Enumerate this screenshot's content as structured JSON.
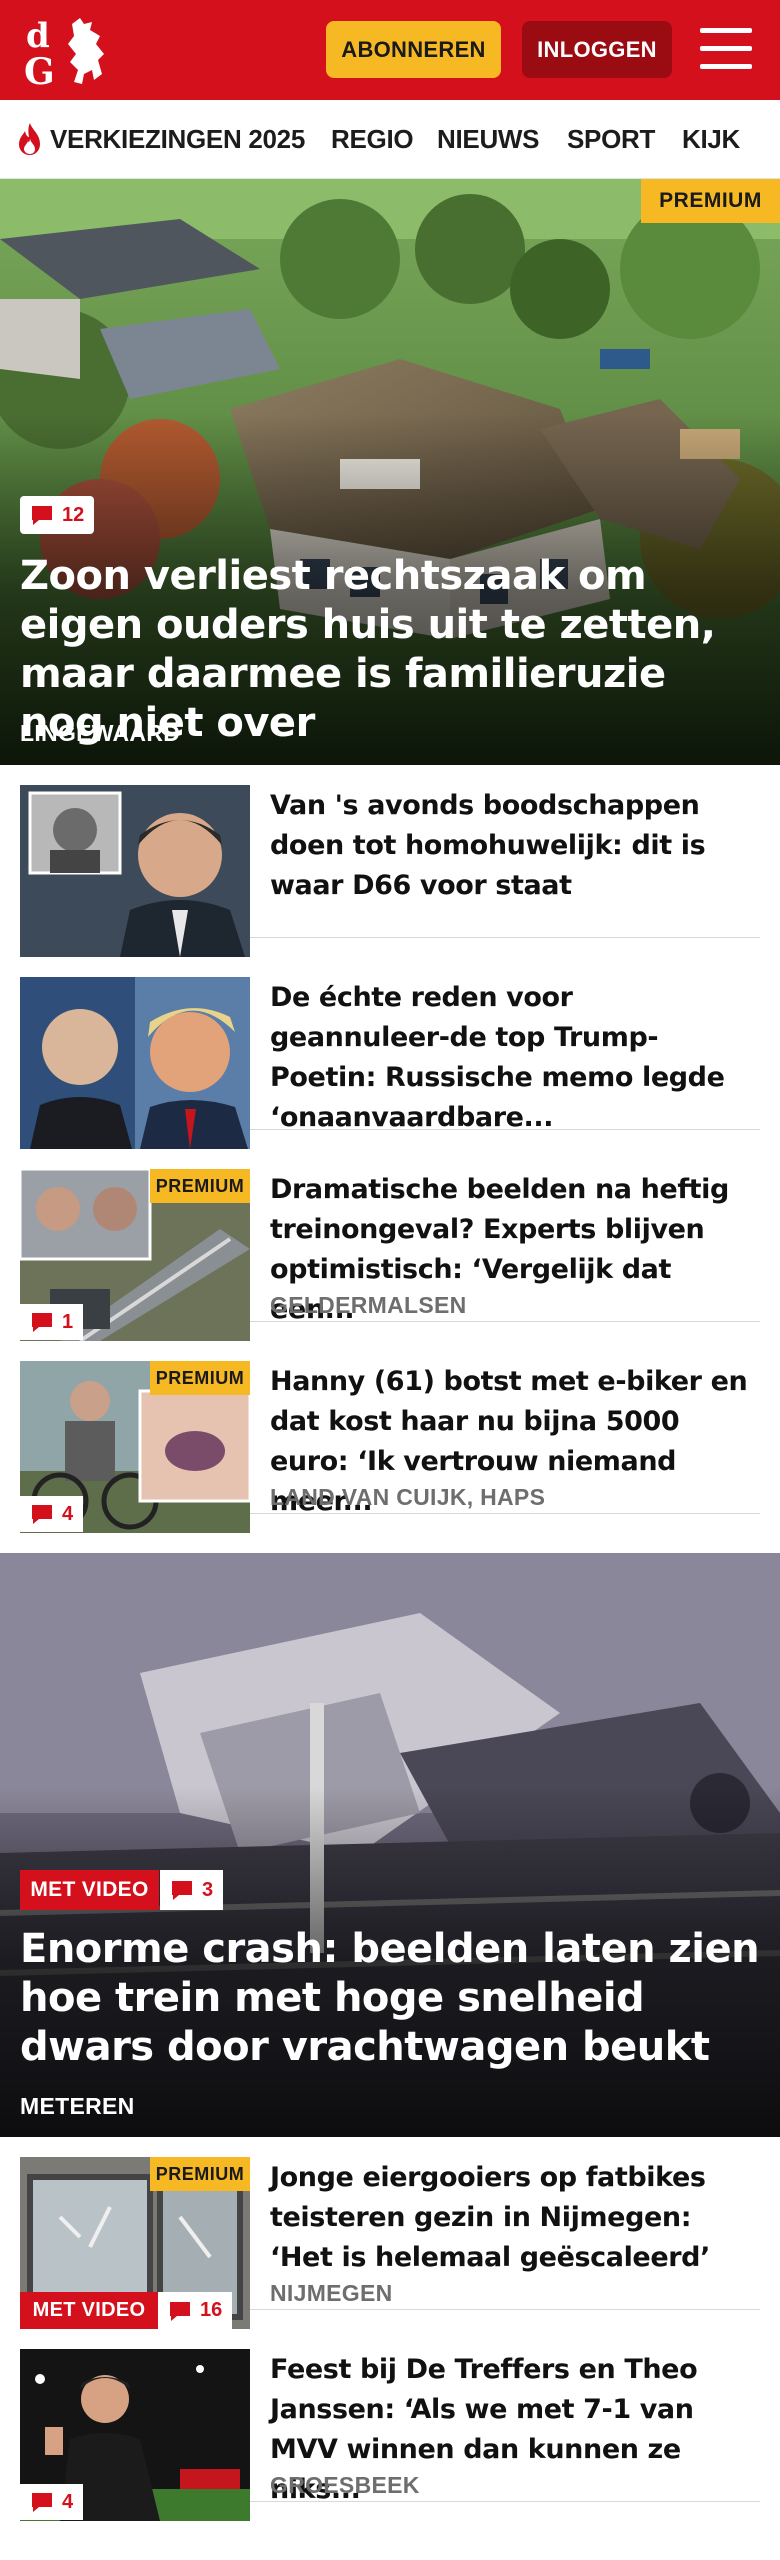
{
  "header": {
    "logo_text": "dG",
    "subscribe_label": "ABONNEREN",
    "login_label": "INLOGGEN",
    "menu_icon": "hamburger-menu-icon",
    "brand_color": "#d3101b",
    "subscribe_color": "#f7b923"
  },
  "nav": {
    "items": [
      {
        "label": "VERKIEZINGEN 2025",
        "icon": "flame-icon"
      },
      {
        "label": "REGIO"
      },
      {
        "label": "NIEUWS"
      },
      {
        "label": "SPORT"
      },
      {
        "label": "KIJK"
      }
    ]
  },
  "hero": {
    "premium": "PREMIUM",
    "comments": "12",
    "title": "Zoon verliest rechtszaak om eigen ouders huis uit te zetten, maar daarmee is familieruzie nog niet over",
    "place": "LINGEWAARD"
  },
  "articles": [
    {
      "title": "Van 's avonds boodschappen doen tot homohuwelijk: dit is waar D66 voor staat",
      "place": "",
      "premium": "",
      "comments": ""
    },
    {
      "title": "De échte reden voor geannuleer-de top Trump-Poetin: Russische memo legde ‘onaanvaardbare...",
      "place": "",
      "premium": "",
      "comments": ""
    },
    {
      "title": "Dramatische beelden na heftig treinongeval? Experts blijven optimistisch: ‘Vergelijk dat een...",
      "place": "GELDERMALSEN",
      "premium": "PREMIUM",
      "comments": "1"
    },
    {
      "title": "Hanny (61) botst met e-biker en dat kost haar nu bijna 5000 euro: ‘Ik vertrouw niemand meer...",
      "place": "LAND VAN CUIJK, HAPS",
      "premium": "PREMIUM",
      "comments": "4"
    }
  ],
  "video_hero": {
    "video_label": "MET VIDEO",
    "comments": "3",
    "title": "Enorme crash: beelden laten zien hoe trein met hoge snelheid dwars door vrachtwagen beukt",
    "place": "METEREN"
  },
  "articles2": [
    {
      "title": "Jonge eiergooiers op fatbikes teisteren gezin in Nijmegen: ‘Het is helemaal geëscaleerd’",
      "place": "NIJMEGEN",
      "premium": "PREMIUM",
      "video_label": "MET VIDEO",
      "comments": "16"
    },
    {
      "title": "Feest bij De Treffers en Theo Janssen: ‘Als we met 7-1 van MVV winnen dan kunnen ze niks...",
      "place": "GROESBEEK",
      "premium": "",
      "comments": "4"
    }
  ]
}
